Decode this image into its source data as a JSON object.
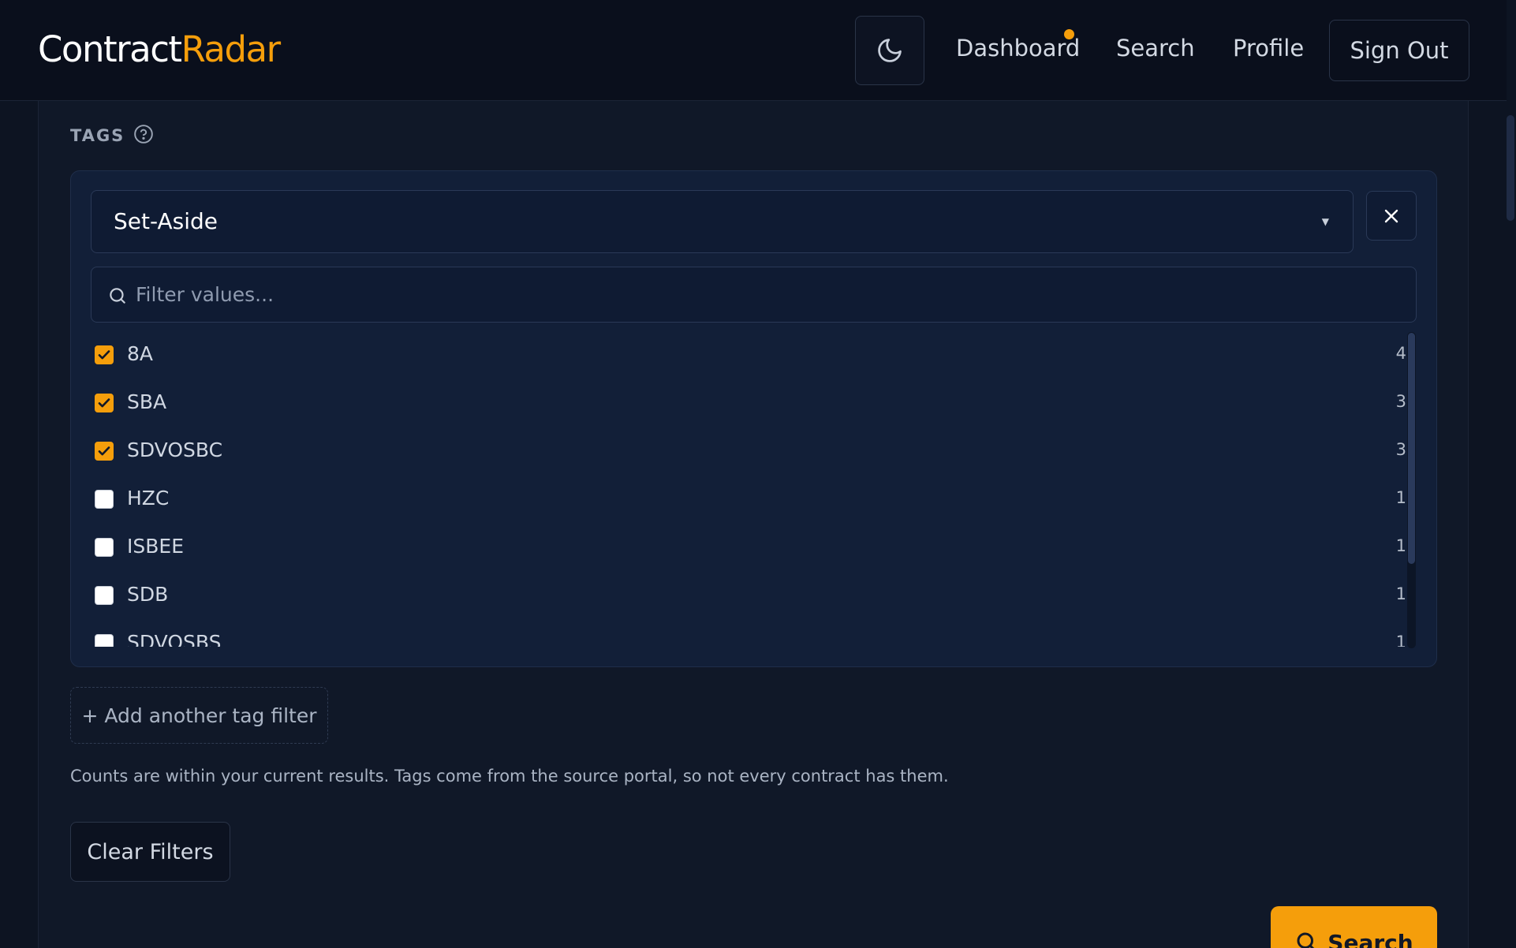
{
  "header": {
    "logo_main": "Contract",
    "logo_accent": "Radar",
    "nav": {
      "dashboard": "Dashboard",
      "search": "Search",
      "profile": "Profile"
    },
    "sign_out": "Sign Out",
    "theme_icon": "moon-icon"
  },
  "tags": {
    "section_label": "TAGS",
    "selected_tag": "Set-Aside",
    "filter_placeholder": "Filter values...",
    "options": [
      {
        "label": "8A",
        "count": "4",
        "checked": true
      },
      {
        "label": "SBA",
        "count": "3",
        "checked": true
      },
      {
        "label": "SDVOSBC",
        "count": "3",
        "checked": true
      },
      {
        "label": "HZC",
        "count": "1",
        "checked": false
      },
      {
        "label": "ISBEE",
        "count": "1",
        "checked": false
      },
      {
        "label": "SDB",
        "count": "1",
        "checked": false
      },
      {
        "label": "SDVOSBS",
        "count": "1",
        "checked": false
      }
    ],
    "add_filter": "+ Add another tag filter",
    "help_text": "Counts are within your current results. Tags come from the source portal, so not every contract has them."
  },
  "actions": {
    "clear": "Clear Filters",
    "search": "Search"
  },
  "colors": {
    "accent": "#f59e0b",
    "background": "#0d1422",
    "panel": "#121f38"
  }
}
